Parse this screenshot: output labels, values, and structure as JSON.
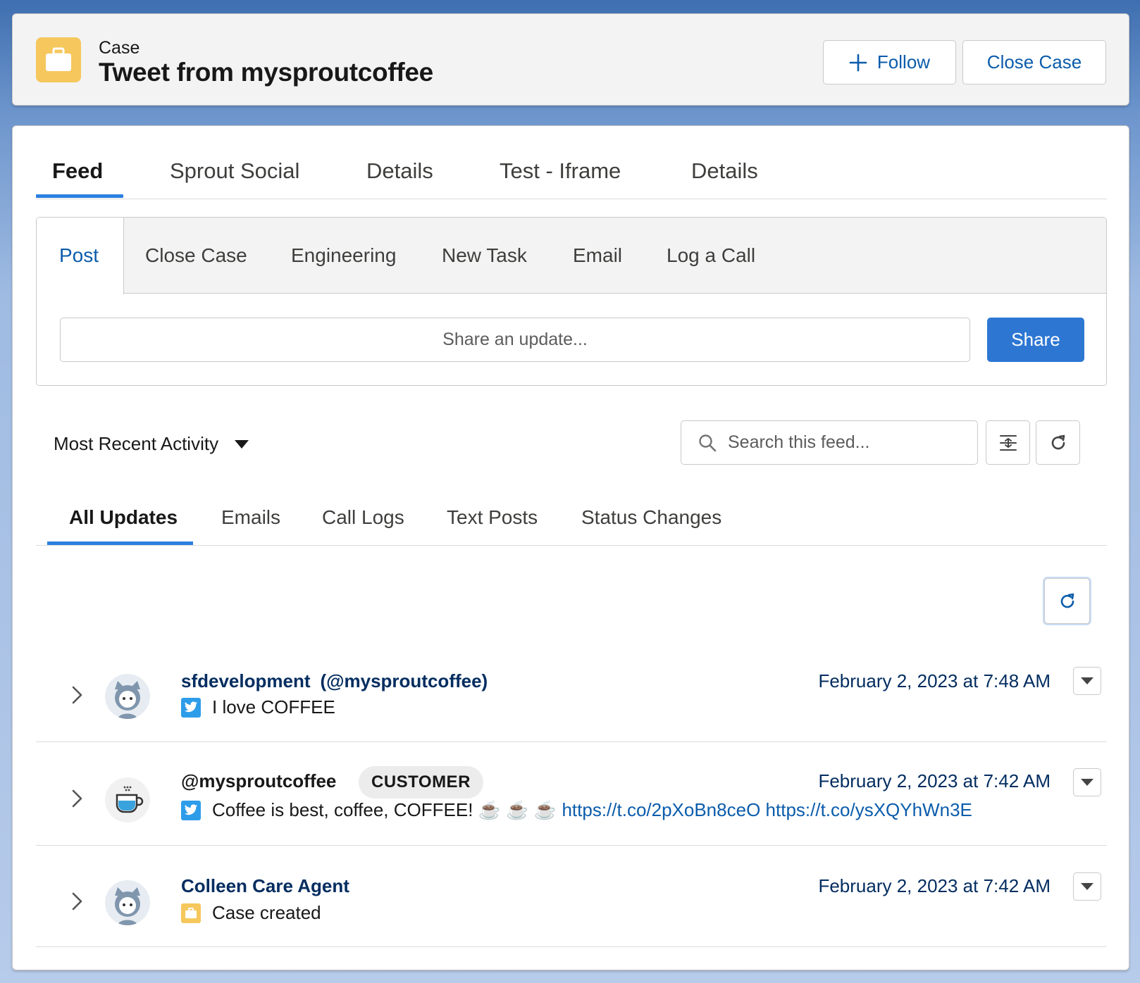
{
  "header": {
    "object_label": "Case",
    "record_title": "Tweet from mysproutcoffee",
    "follow_label": "Follow",
    "close_case_label": "Close Case"
  },
  "tabs": [
    {
      "label": "Feed",
      "active": true
    },
    {
      "label": "Sprout Social"
    },
    {
      "label": "Details"
    },
    {
      "label": "Test - Iframe"
    },
    {
      "label": "Details"
    }
  ],
  "publisher": {
    "tabs": [
      {
        "label": "Post",
        "active": true
      },
      {
        "label": "Close Case"
      },
      {
        "label": "Engineering"
      },
      {
        "label": "New Task"
      },
      {
        "label": "Email"
      },
      {
        "label": "Log a Call"
      }
    ],
    "placeholder": "Share an update...",
    "share_label": "Share"
  },
  "feed_controls": {
    "sort_label": "Most Recent Activity",
    "search_placeholder": "Search this feed..."
  },
  "feed_tabs": [
    {
      "label": "All Updates",
      "active": true
    },
    {
      "label": "Emails"
    },
    {
      "label": "Call Logs"
    },
    {
      "label": "Text Posts"
    },
    {
      "label": "Status Changes"
    }
  ],
  "feed_items": [
    {
      "actor": "sfdevelopment",
      "handle": "(@mysproutcoffee)",
      "timestamp": "February 2, 2023 at 7:48 AM",
      "source_icon": "twitter-icon",
      "message": "I love COFFEE"
    },
    {
      "actor": "@mysproutcoffee",
      "badge": "CUSTOMER",
      "timestamp": "February 2, 2023 at 7:42 AM",
      "source_icon": "twitter-icon",
      "message": "Coffee is best, coffee, COFFEE! ☕ ☕ ☕",
      "links": [
        "https://t.co/2pXoBn8ceO",
        "https://t.co/ysXQYhWn3E"
      ]
    },
    {
      "actor": "Colleen Care Agent",
      "timestamp": "February 2, 2023 at 7:42 AM",
      "source_icon": "case-icon",
      "message": "Case created"
    }
  ],
  "colors": {
    "brand_blue": "#2d77d3",
    "link_blue": "#0b5cab",
    "case_yellow": "#f5c75c",
    "twitter_blue": "#2d9de9"
  }
}
